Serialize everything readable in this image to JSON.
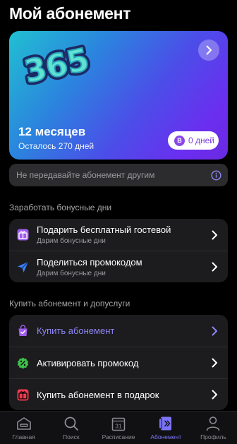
{
  "header": {
    "title": "Мой абонемент"
  },
  "hero": {
    "logo_text": "365",
    "period": "12 месяцев",
    "remaining": "Осталось 270 дней",
    "bonus_badge": "В",
    "bonus_label": "0 дней"
  },
  "notice": {
    "text": "Не передавайте абонемент другим"
  },
  "bonus_section": {
    "title": "Заработать бонусные дни",
    "items": [
      {
        "title": "Подарить бесплатный гостевой",
        "subtitle": "Дарим бонусные дни",
        "icon": "gift-icon"
      },
      {
        "title": "Поделиться промокодом",
        "subtitle": "Дарим бонусные дни",
        "icon": "send-icon"
      }
    ]
  },
  "buy_section": {
    "title": "Купить абонемент и допуслуги",
    "items": [
      {
        "title": "Купить абонемент",
        "icon": "shopping-bag-icon"
      },
      {
        "title": "Активировать промокод",
        "icon": "percent-badge-icon"
      },
      {
        "title": "Купить абонемент в подарок",
        "icon": "gift-box-icon"
      }
    ]
  },
  "tabbar": {
    "tabs": [
      {
        "label": "Главная",
        "icon": "home-icon"
      },
      {
        "label": "Поиск",
        "icon": "search-icon"
      },
      {
        "label": "Расписание",
        "icon": "calendar-icon",
        "icon_text": "31"
      },
      {
        "label": "Абонемент",
        "icon": "membership-icon"
      },
      {
        "label": "Профиль",
        "icon": "profile-icon"
      }
    ],
    "active_index": 3
  },
  "colors": {
    "accent": "#7b74f7",
    "bonus_purple": "#8b46e8",
    "icon_purple": "#a05cf0",
    "icon_blue": "#3b82f6",
    "icon_green": "#3ec24a",
    "icon_red": "#ef3b4f"
  }
}
